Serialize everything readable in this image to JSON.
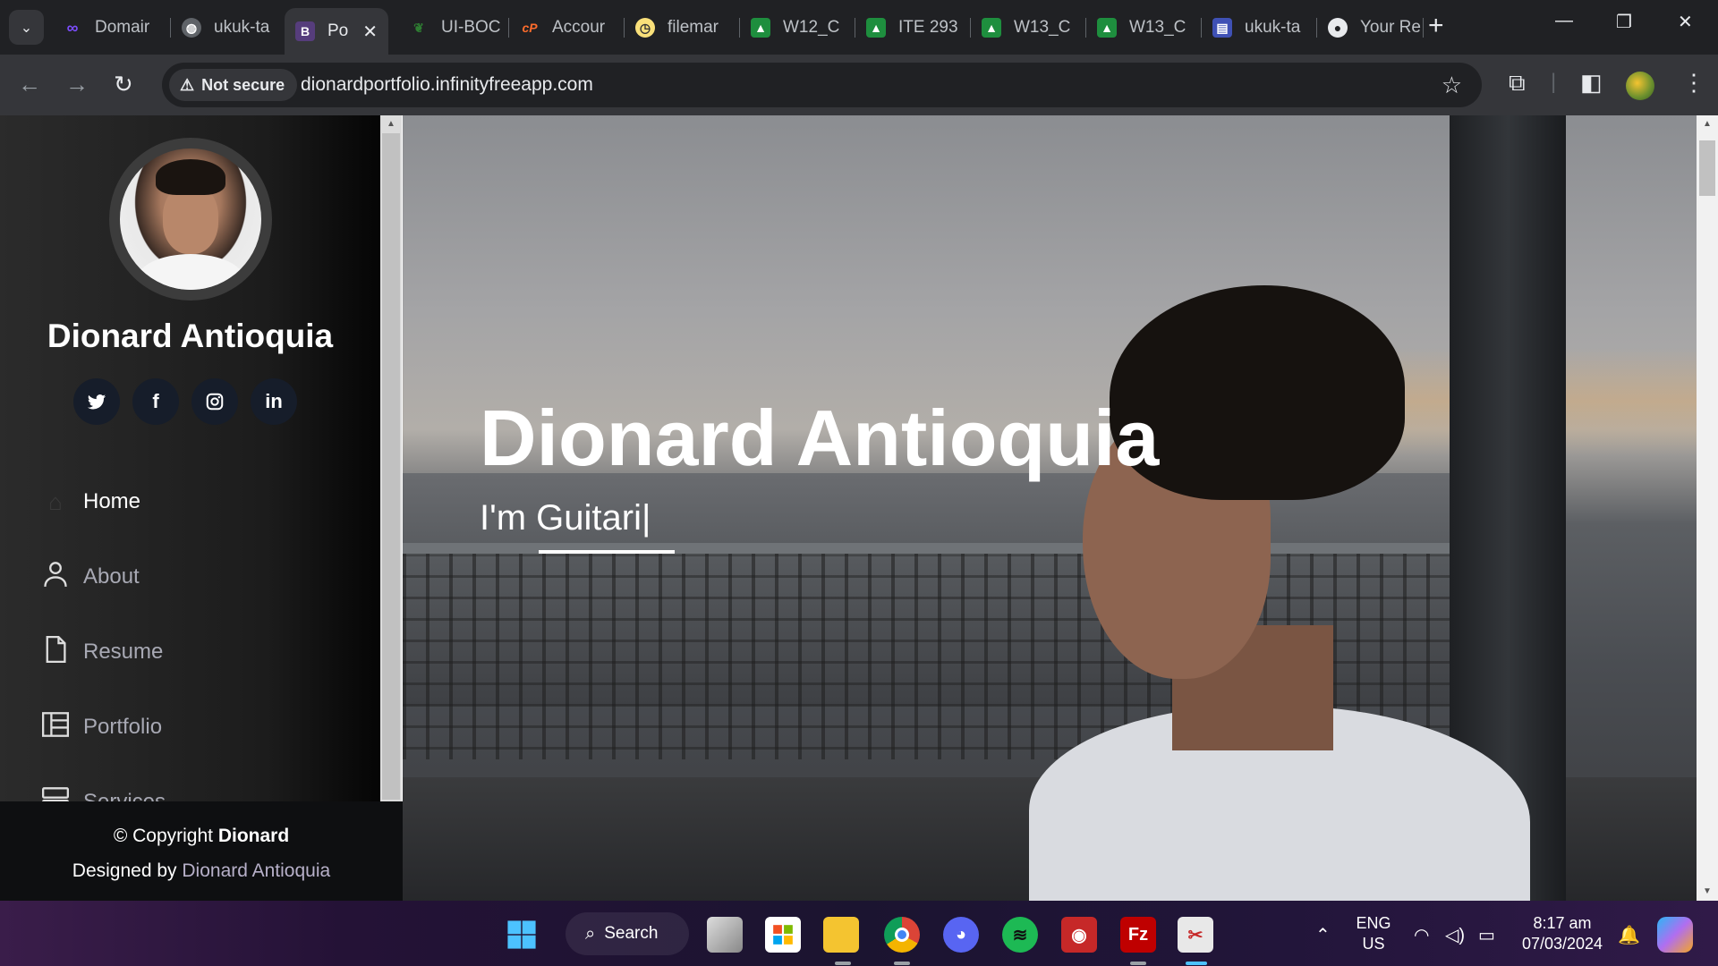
{
  "browser": {
    "tabs": [
      {
        "label": "Domair",
        "icon": "infinity-icon",
        "color": "#7c4dff"
      },
      {
        "label": "ukuk-ta",
        "icon": "globe-icon",
        "color": "#9aa0a6"
      },
      {
        "label": "Po",
        "icon": "bootstrap-icon",
        "color": "#563d7c",
        "active": true
      },
      {
        "label": "UI-BOC",
        "icon": "leaf-icon",
        "color": "#2e7d32"
      },
      {
        "label": "Accour",
        "icon": "cpanel-icon",
        "color": "#ff6c2c"
      },
      {
        "label": "filemar",
        "icon": "clock-icon",
        "color": "#f9e07a"
      },
      {
        "label": "W12_C",
        "icon": "classroom-icon",
        "color": "#1e8e3e"
      },
      {
        "label": "ITE 293",
        "icon": "classroom-icon",
        "color": "#1e8e3e"
      },
      {
        "label": "W13_C",
        "icon": "classroom-icon",
        "color": "#1e8e3e"
      },
      {
        "label": "W13_C",
        "icon": "classroom-icon",
        "color": "#1e8e3e"
      },
      {
        "label": "ukuk-ta",
        "icon": "layout-icon",
        "color": "#3f51b5"
      },
      {
        "label": "Your Re",
        "icon": "github-icon",
        "color": "#e8eaed"
      }
    ],
    "security_label": "Not secure",
    "url": "dionardportfolio.infinityfreeapp.com"
  },
  "sidebar": {
    "name": "Dionard Antioquia",
    "socials": [
      {
        "icon": "twitter-icon",
        "glyph": "🐦"
      },
      {
        "icon": "facebook-icon",
        "glyph": "f"
      },
      {
        "icon": "instagram-icon",
        "glyph": "◎"
      },
      {
        "icon": "linkedin-icon",
        "glyph": "in"
      }
    ],
    "menu": [
      {
        "label": "Home",
        "icon": "home-icon",
        "active": true
      },
      {
        "label": "About",
        "icon": "person-icon"
      },
      {
        "label": "Resume",
        "icon": "file-icon"
      },
      {
        "label": "Portfolio",
        "icon": "portfolio-icon"
      },
      {
        "label": "Services",
        "icon": "server-icon"
      }
    ]
  },
  "footer": {
    "copyright_prefix": "© Copyright",
    "copyright_name": "Dionard",
    "designed_prefix": "Designed by",
    "designed_link": "Dionard Antioquia"
  },
  "hero": {
    "title": "Dionard Antioquia",
    "subtitle": "I'm Guitari|"
  },
  "taskbar": {
    "search_label": "Search",
    "language_line1": "ENG",
    "language_line2": "US",
    "time": "8:17 am",
    "date": "07/03/2024",
    "accent": "#4cc2ff"
  }
}
